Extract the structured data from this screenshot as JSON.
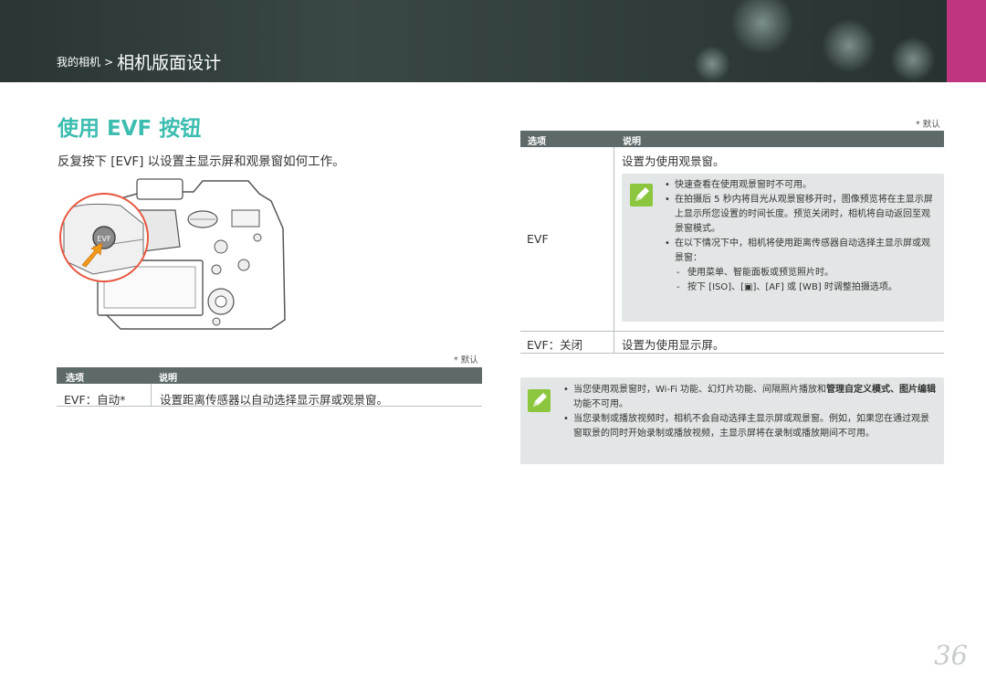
{
  "header": {
    "breadcrumb_parent": "我的相机",
    "breadcrumb_separator": ">",
    "breadcrumb_current": "相机版面设计",
    "accent_color": "#c0357f"
  },
  "section": {
    "title": "使用 EVF 按钮",
    "intro": "反复按下 [EVF] 以设置主显示屏和观景窗如何工作。",
    "camera_button_label": "EVF"
  },
  "left_table": {
    "default_note": "* 默认",
    "col_option": "选项",
    "col_desc": "说明",
    "rows": [
      {
        "option": "EVF：自动*",
        "desc": "设置距离传感器以自动选择显示屏或观景窗。"
      }
    ]
  },
  "right_table": {
    "default_note": "* 默认",
    "col_option": "选项",
    "col_desc": "说明",
    "evf_option": "EVF",
    "evf_desc": "设置为使用观景窗。",
    "evf_notes": [
      "快速查看在使用观景窗时不可用。",
      "在拍摄后 5 秒内将目光从观景窗移开时，图像预览将在主显示屏上显示所您设置的时间长度。预览关闭时，相机将自动返回至观景窗模式。",
      "在以下情况下中，相机将使用距离传感器自动选择主显示屏或观景窗："
    ],
    "evf_subnotes": [
      "使用菜单、智能面板或预览照片时。",
      "按下 [ISO]、[▣]、[AF] 或 [WB] 时调整拍摄选项。"
    ],
    "off_option": "EVF：关闭",
    "off_desc": "设置为使用显示屏。"
  },
  "bottom_note": {
    "item1_prefix": "当您使用观景窗时，Wi-Fi 功能、幻灯片功能、间隔照片播放和",
    "item1_bold": "管理自定义模式、图片编辑",
    "item1_suffix": "功能不可用。",
    "item2": "当您录制或播放视频时，相机不会自动选择主显示屏或观景窗。例如，如果您在通过观景窗取景的同时开始录制或播放视频，主显示屏将在录制或播放期间不可用。"
  },
  "icons": {
    "note": "pen-note-icon",
    "accent_green": "#8cc63f",
    "title_color": "#3dbdb0"
  },
  "page_number": "36"
}
